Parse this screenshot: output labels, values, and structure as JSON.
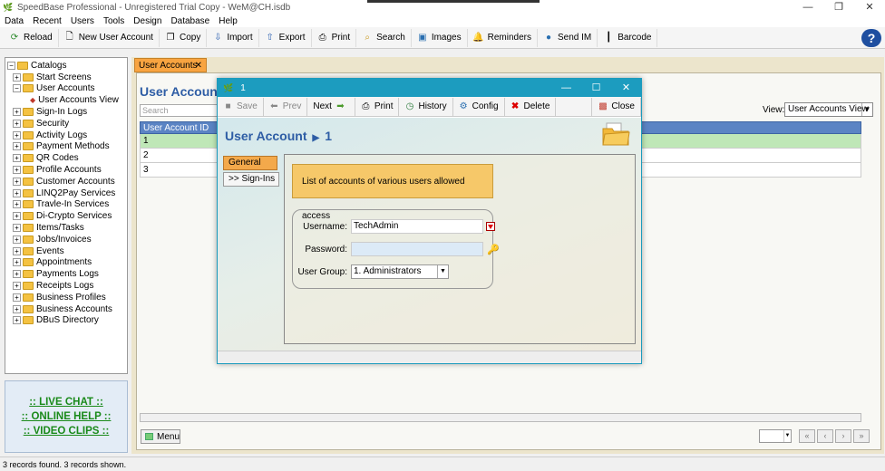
{
  "window": {
    "title": "SpeedBase Professional - Unregistered Trial Copy - WeM@CH.isdb",
    "controls": [
      "—",
      "❐",
      "✕"
    ]
  },
  "menu": [
    "Data",
    "Recent",
    "Users",
    "Tools",
    "Design",
    "Database",
    "Help"
  ],
  "toolbar": [
    {
      "label": "Reload",
      "icon": "reload-icon"
    },
    {
      "label": "New User Account",
      "icon": "new-document-icon"
    },
    {
      "label": "Copy",
      "icon": "copy-icon"
    },
    {
      "label": "Import",
      "icon": "import-icon"
    },
    {
      "label": "Export",
      "icon": "export-icon"
    },
    {
      "label": "Print",
      "icon": "print-icon"
    },
    {
      "label": "Search",
      "icon": "search-icon"
    },
    {
      "label": "Images",
      "icon": "images-icon"
    },
    {
      "label": "Reminders",
      "icon": "reminders-icon"
    },
    {
      "label": "Send IM",
      "icon": "chat-icon"
    },
    {
      "label": "Barcode",
      "icon": "barcode-icon"
    }
  ],
  "help": "?",
  "tree": [
    {
      "label": "Catalogs",
      "level": 0
    },
    {
      "label": "Start Screens",
      "level": 1
    },
    {
      "label": "User Accounts",
      "level": 1
    },
    {
      "label": "User Accounts View",
      "level": 2
    },
    {
      "label": "Sign-In Logs",
      "level": 1
    },
    {
      "label": "Security",
      "level": 1
    },
    {
      "label": "Activity Logs",
      "level": 1
    },
    {
      "label": "Payment Methods",
      "level": 1
    },
    {
      "label": "QR Codes",
      "level": 1
    },
    {
      "label": "Profile Accounts",
      "level": 1
    },
    {
      "label": "Customer Accounts",
      "level": 1
    },
    {
      "label": "LINQ2Pay Services",
      "level": 1
    },
    {
      "label": "Travle-In Services",
      "level": 1
    },
    {
      "label": "Di-Crypto Services",
      "level": 1
    },
    {
      "label": "Items/Tasks",
      "level": 1
    },
    {
      "label": "Jobs/Invoices",
      "level": 1
    },
    {
      "label": "Events",
      "level": 1
    },
    {
      "label": "Appointments",
      "level": 1
    },
    {
      "label": "Payments Logs",
      "level": 1
    },
    {
      "label": "Receipts Logs",
      "level": 1
    },
    {
      "label": "Business Profiles",
      "level": 1
    },
    {
      "label": "Business Accounts",
      "level": 1
    },
    {
      "label": "DBuS Directory",
      "level": 1
    }
  ],
  "links": [
    ":: LIVE CHAT ::",
    ":: ONLINE HELP ::",
    ":: VIDEO CLIPS ::"
  ],
  "main": {
    "tab_label": "User Accounts",
    "tab_close": "✕",
    "heading": "User Accounts",
    "search_placeholder": "Search",
    "view_label": "View:",
    "view_value": "User Accounts View",
    "grid_header": "User Account ID",
    "rows": [
      "1",
      "2",
      "3"
    ],
    "menu_button": "Menu"
  },
  "status": "3 records found. 3 records shown.",
  "dialog": {
    "title": "1",
    "toolbar": {
      "save": "Save",
      "prev": "Prev",
      "next": "Next",
      "print": "Print",
      "history": "History",
      "config": "Config",
      "delete": "Delete",
      "close": "Close"
    },
    "heading": "User Account",
    "heading_id": "1",
    "tabs": {
      "general": "General",
      "signins": ">> Sign-Ins"
    },
    "info": "List of accounts of various users allowed access",
    "fields": {
      "username_label": "Username:",
      "username_value": "TechAdmin",
      "password_label": "Password:",
      "password_value": "",
      "group_label": "User Group:",
      "group_value": "1. Administrators"
    }
  }
}
